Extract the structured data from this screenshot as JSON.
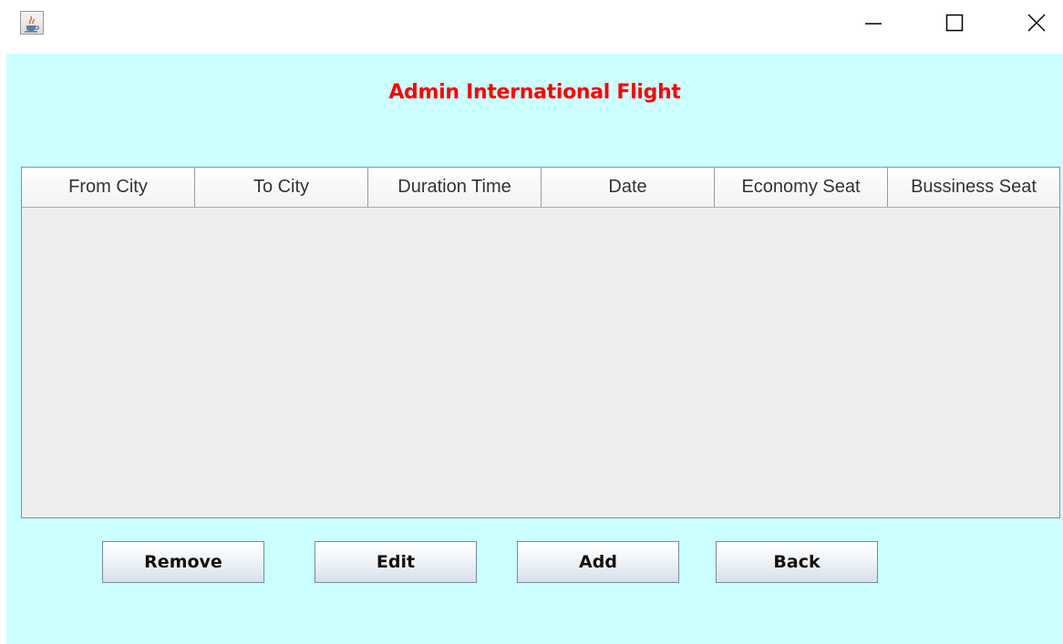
{
  "window": {
    "icons": {
      "app": "java-cup-icon",
      "minimize": "minimize-icon",
      "maximize": "maximize-icon",
      "close": "close-icon"
    }
  },
  "page": {
    "title": "Admin International Flight"
  },
  "table": {
    "columns": [
      "From City",
      "To City",
      "Duration Time",
      "Date",
      "Economy Seat",
      "Bussiness Seat"
    ],
    "rows": []
  },
  "buttons": {
    "remove": "Remove",
    "edit": "Edit",
    "add": "Add",
    "back": "Back"
  },
  "colors": {
    "background": "#ccffff",
    "title": "#ff0000",
    "table_body": "#eeeeee"
  }
}
